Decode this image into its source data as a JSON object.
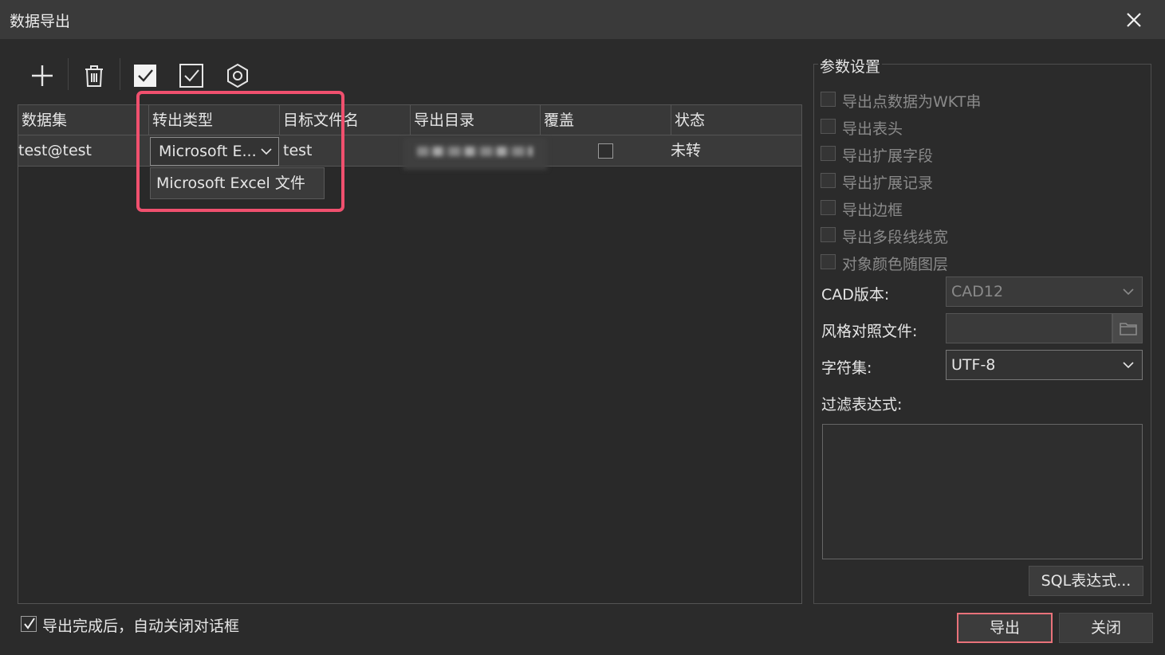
{
  "window": {
    "title": "数据导出"
  },
  "toolbar": {
    "icons": [
      "plus-icon",
      "trash-icon",
      "check-all-icon",
      "check-icon",
      "settings-icon"
    ]
  },
  "table": {
    "columns": [
      "数据集",
      "转出类型",
      "目标文件名",
      "导出目录",
      "覆盖",
      "状态"
    ],
    "rows": [
      {
        "dataset": "test@test",
        "type": "Microsoft E...",
        "filename": "test",
        "directory": "",
        "overwrite": false,
        "status": "未转"
      }
    ],
    "dropdown_options": [
      "Microsoft Excel 文件"
    ]
  },
  "footer": {
    "auto_close_label": "导出完成后，自动关闭对话框",
    "auto_close_checked": true,
    "export_button": "导出",
    "close_button": "关闭"
  },
  "params": {
    "title": "参数设置",
    "options": [
      "导出点数据为WKT串",
      "导出表头",
      "导出扩展字段",
      "导出扩展记录",
      "导出边框",
      "导出多段线线宽",
      "对象颜色随图层"
    ],
    "cad_version_label": "CAD版本:",
    "cad_version_value": "CAD12",
    "style_file_label": "风格对照文件:",
    "charset_label": "字符集:",
    "charset_value": "UTF-8",
    "filter_label": "过滤表达式:",
    "sql_button": "SQL表达式..."
  },
  "colors": {
    "highlight": "#f0506e",
    "primary_border": "#e9727a"
  }
}
